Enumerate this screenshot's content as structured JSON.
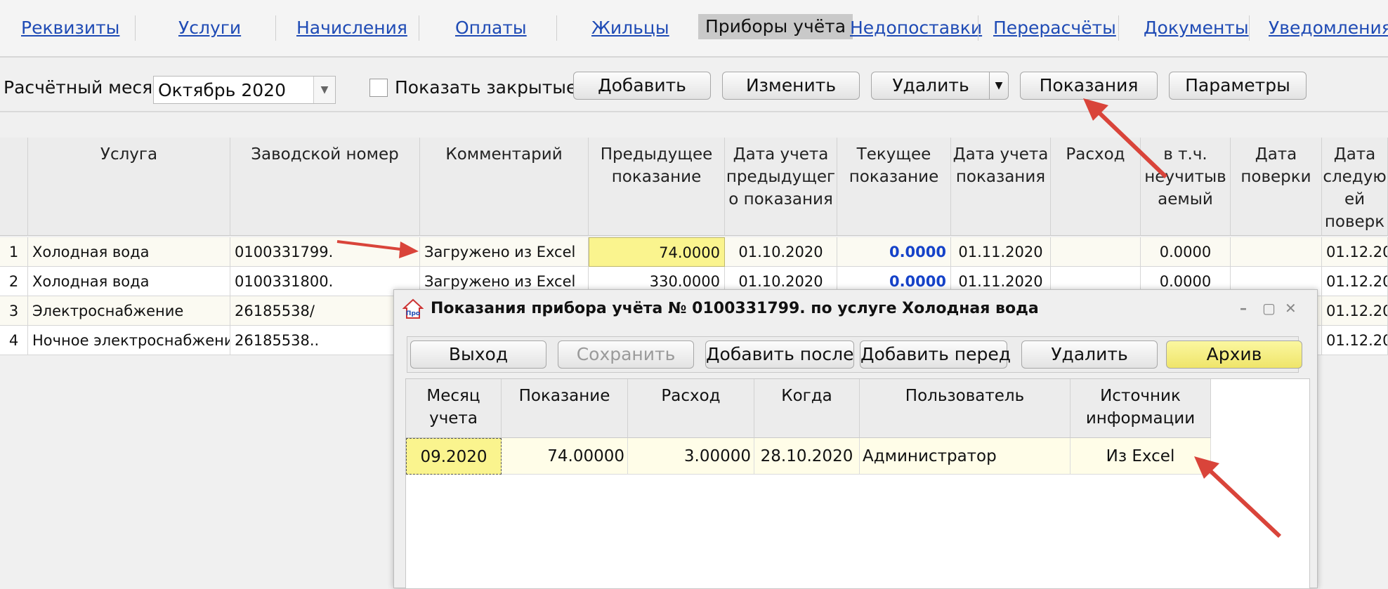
{
  "tabs": [
    "Реквизиты",
    "Услуги",
    "Начисления",
    "Оплаты",
    "Жильцы",
    "Приборы учёта",
    "Недопоставки",
    "Перерасчёты",
    "Документы",
    "Уведомления"
  ],
  "toolbar": {
    "month_label": "Расчётный месяц",
    "month_value": "Октябрь 2020",
    "show_closed": "Показать закрытые",
    "add": "Добавить",
    "edit": "Изменить",
    "delete": "Удалить",
    "readings": "Показания",
    "params": "Параметры"
  },
  "table": {
    "headers": [
      "Услуга",
      "Заводской номер",
      "Комментарий",
      "Предыдущее показание",
      "Дата учета предыдущег о показания",
      "Текущее показание",
      "Дата учета показания",
      "Расход",
      "в т.ч. неучитыв аемый",
      "Дата поверки",
      "Дата следую ей поверк"
    ],
    "rows": [
      {
        "n": "1",
        "service": "Холодная вода",
        "serial": "0100331799.",
        "comment": "Загружено из Excel",
        "prev": "74.0000",
        "prev_date": "01.10.2020",
        "cur": "0.0000",
        "cur_date": "01.11.2020",
        "usage": "",
        "unaccounted": "0.0000",
        "check": "",
        "next": "01.12.20"
      },
      {
        "n": "2",
        "service": "Холодная вода",
        "serial": "0100331800.",
        "comment": "Загружено из Excel",
        "prev": "330.0000",
        "prev_date": "01.10.2020",
        "cur": "0.0000",
        "cur_date": "01.11.2020",
        "usage": "",
        "unaccounted": "0.0000",
        "check": "",
        "next": "01.12.20"
      },
      {
        "n": "3",
        "service": "Электроснабжение",
        "serial": "26185538/",
        "comment": "",
        "prev": "",
        "prev_date": "",
        "cur": "",
        "cur_date": "",
        "usage": "",
        "unaccounted": "",
        "check": "",
        "next": "01.12.20"
      },
      {
        "n": "4",
        "service": "Ночное электроснабжение",
        "serial": "26185538..",
        "comment": "",
        "prev": "",
        "prev_date": "",
        "cur": "",
        "cur_date": "",
        "usage": "",
        "unaccounted": "",
        "check": "",
        "next": "01.12.20"
      }
    ]
  },
  "dialog": {
    "title": "Показания прибора учёта № 0100331799. по услуге Холодная вода",
    "buttons": {
      "exit": "Выход",
      "save": "Сохранить",
      "add_after": "Добавить после",
      "add_before": "Добавить перед",
      "delete": "Удалить",
      "archive": "Архив"
    },
    "headers": [
      "Месяц учета",
      "Показание",
      "Расход",
      "Когда",
      "Пользователь",
      "Источник информации"
    ],
    "row": {
      "month": "09.2020",
      "reading": "74.00000",
      "usage": "3.00000",
      "when": "28.10.2020",
      "user": "Администратор",
      "source": "Из Excel"
    }
  },
  "colors": {
    "link": "#1f4bb5",
    "highlight": "#faf48e",
    "annotation_arrow": "#d9443a",
    "value_blue": "#1542c9"
  }
}
